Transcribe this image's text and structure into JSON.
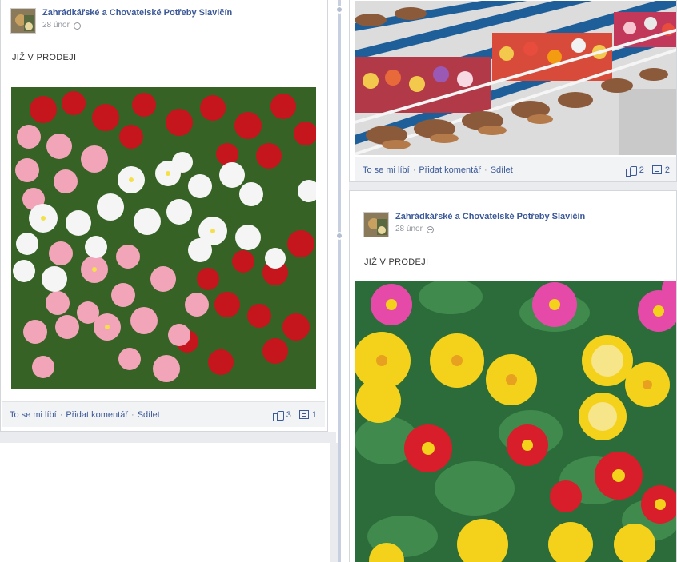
{
  "posts": [
    {
      "author": "Zahrádkářské a Chovatelské Potřeby Slavičín",
      "date": "28 únor",
      "text": "JIŽ V PRODEJI",
      "photo": "pink-red-white-daisies",
      "actions": {
        "like": "To se mi líbí",
        "comment": "Přidat komentář",
        "share": "Sdílet",
        "separator": "·"
      },
      "likes": "3",
      "comments": "1"
    },
    {
      "photo": "flower-bulbs-display-crates",
      "actions": {
        "like": "To se mi líbí",
        "comment": "Přidat komentář",
        "share": "Sdílet",
        "separator": "·"
      },
      "likes": "2",
      "comments": "2"
    },
    {
      "author": "Zahrádkářské a Chovatelské Potřeby Slavičín",
      "date": "28 únor",
      "text": "JIŽ V PRODEJI",
      "photo": "yellow-red-pink-primroses"
    }
  ],
  "colors": {
    "link": "#3b5998",
    "meta": "#90949c",
    "spine": "#c7cfe0"
  }
}
